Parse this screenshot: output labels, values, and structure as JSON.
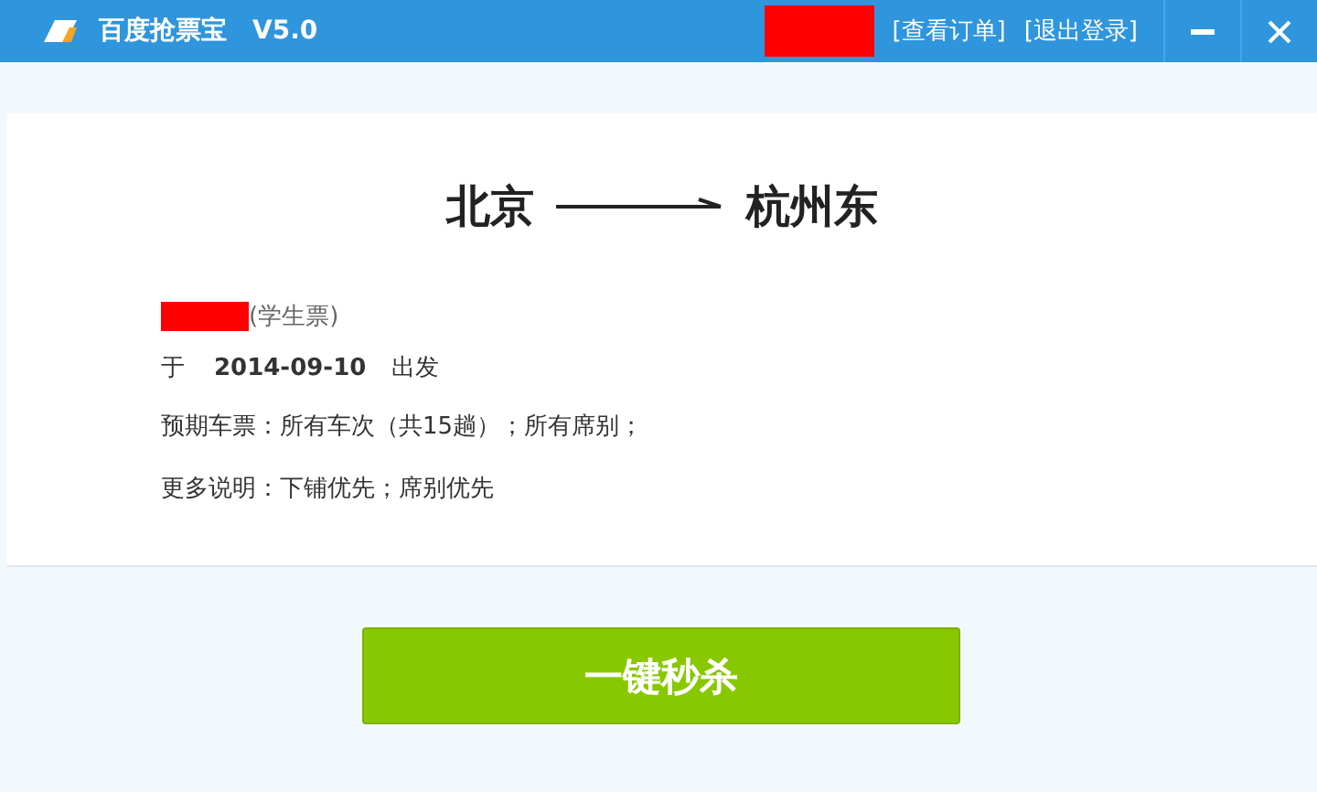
{
  "window": {
    "title": "百度抢票宝",
    "version": "V5.0",
    "links": [
      "[查看订单]",
      "[退出登录]"
    ],
    "controls": [
      {
        "kind": "minimize"
      },
      {
        "kind": "close"
      }
    ]
  },
  "route": {
    "from": "北京",
    "to": "杭州东"
  },
  "passenger": {
    "ticket_type": "(学生票)"
  },
  "date": {
    "prefix": "于",
    "value": "2014-09-10",
    "suffix": "出发"
  },
  "details": [
    "预期车票：所有车次（共15趟）；所有席别；",
    "更多说明：下铺优先；席别优先"
  ],
  "action": {
    "label": "一键秒杀"
  }
}
